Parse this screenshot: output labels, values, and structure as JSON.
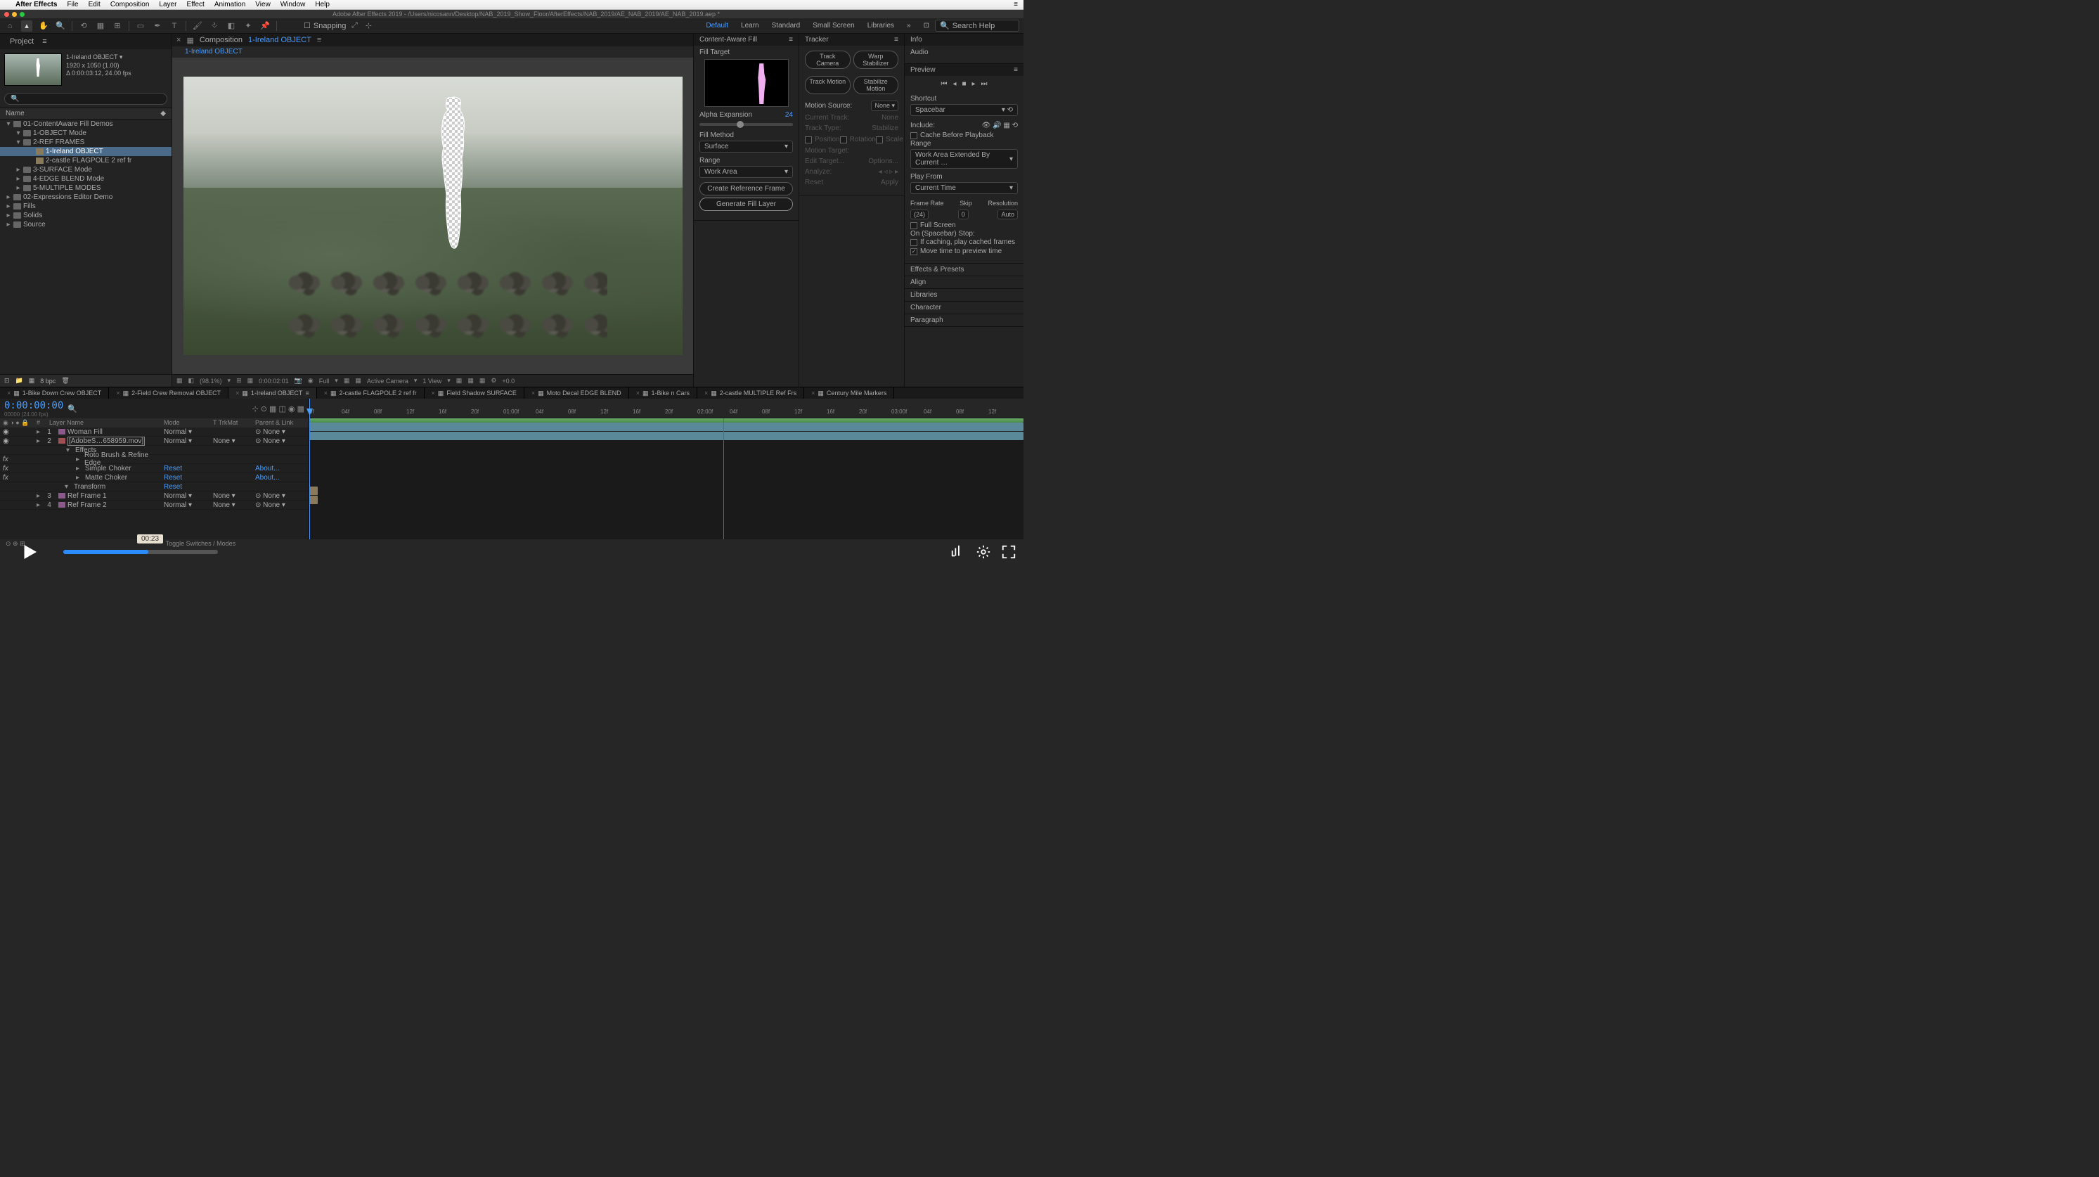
{
  "menubar": {
    "app": "After Effects",
    "items": [
      "File",
      "Edit",
      "Composition",
      "Layer",
      "Effect",
      "Animation",
      "View",
      "Window",
      "Help"
    ]
  },
  "window_title": "Adobe After Effects 2019 - /Users/nicosann/Desktop/NAB_2019_Show_Floor/AfterEffects/NAB_2019/AE_NAB_2019/AE_NAB_2019.aep *",
  "toolbar": {
    "snapping": "Snapping",
    "workspaces": [
      "Default",
      "Learn",
      "Standard",
      "Small Screen",
      "Libraries"
    ],
    "search_placeholder": "Search Help"
  },
  "project": {
    "panel_title": "Project",
    "comp_name": "1-Ireland OBJECT ▾",
    "comp_res": "1920 x 1050 (1.00)",
    "comp_dur": "Δ 0:00:03:12, 24.00 fps",
    "name_header": "Name",
    "tree": [
      {
        "l": 1,
        "t": "folder",
        "open": true,
        "label": "01-ContentAware Fill Demos"
      },
      {
        "l": 2,
        "t": "folder",
        "open": true,
        "label": "1-OBJECT Mode"
      },
      {
        "l": 2,
        "t": "folder",
        "open": true,
        "label": "2-REF FRAMES"
      },
      {
        "l": 3,
        "t": "comp",
        "sel": true,
        "label": "1-Ireland OBJECT"
      },
      {
        "l": 3,
        "t": "comp",
        "label": "2-castle FLAGPOLE 2 ref fr"
      },
      {
        "l": 2,
        "t": "folder",
        "label": "3-SURFACE Mode"
      },
      {
        "l": 2,
        "t": "folder",
        "label": "4-EDGE BLEND Mode"
      },
      {
        "l": 2,
        "t": "folder",
        "label": "5-MULTIPLE MODES"
      },
      {
        "l": 1,
        "t": "folder",
        "label": "02-Expressions Editor Demo"
      },
      {
        "l": 1,
        "t": "folder",
        "label": "Fills"
      },
      {
        "l": 1,
        "t": "folder",
        "label": "Solids"
      },
      {
        "l": 1,
        "t": "folder",
        "label": "Source"
      }
    ],
    "bpc": "8 bpc"
  },
  "composition": {
    "tab_prefix": "Composition",
    "tab_name": "1-Ireland OBJECT",
    "breadcrumb": "1-Ireland OBJECT",
    "footer": {
      "zoom": "(98.1%)",
      "time": "0:00:02:01",
      "res": "Full",
      "camera": "Active Camera",
      "view": "1 View",
      "exposure": "+0.0"
    }
  },
  "caf": {
    "title": "Content-Aware Fill",
    "fill_target": "Fill Target",
    "alpha_exp": "Alpha Expansion",
    "alpha_val": "24",
    "fill_method": "Fill Method",
    "fill_method_val": "Surface",
    "range": "Range",
    "range_val": "Work Area",
    "btn_ref": "Create Reference Frame",
    "btn_gen": "Generate Fill Layer"
  },
  "tracker": {
    "title": "Tracker",
    "btns": [
      "Track Camera",
      "Warp Stabilizer",
      "Track Motion",
      "Stabilize Motion"
    ],
    "motion_source": "Motion Source:",
    "motion_source_val": "None",
    "current_track": "Current Track:",
    "current_track_val": "None",
    "track_type": "Track Type:",
    "track_type_val": "Stabilize",
    "opts": [
      "Position",
      "Rotation",
      "Scale"
    ],
    "motion_target": "Motion Target:",
    "edit_target": "Edit Target...",
    "options": "Options...",
    "analyze": "Analyze:",
    "reset": "Reset",
    "apply": "Apply"
  },
  "info": {
    "title": "Info",
    "audio": "Audio"
  },
  "preview": {
    "title": "Preview",
    "shortcut": "Shortcut",
    "shortcut_val": "Spacebar",
    "include": "Include:",
    "cache": "Cache Before Playback",
    "range": "Range",
    "range_val": "Work Area Extended By Current …",
    "play_from": "Play From",
    "play_from_val": "Current Time",
    "frame_rate": "Frame Rate",
    "skip": "Skip",
    "resolution": "Resolution",
    "fr_val": "(24)",
    "skip_val": "0",
    "res_val": "Auto",
    "fullscreen": "Full Screen",
    "on_stop": "On (Spacebar) Stop:",
    "cached": "If caching, play cached frames",
    "move_time": "Move time to preview time"
  },
  "panels_collapsed": [
    "Effects & Presets",
    "Align",
    "Libraries",
    "Character",
    "Paragraph"
  ],
  "timeline": {
    "tabs": [
      "1-Bike Down Crew OBJECT",
      "2-Field Crew Removal OBJECT",
      "1-Ireland OBJECT",
      "2-castle FLAGPOLE 2 ref fr",
      "Field Shadow SURFACE",
      "Moto Decal EDGE BLEND",
      "1-Bike n Cars",
      "2-castle MULTIPLE Ref Frs",
      "Century Mile Markers"
    ],
    "active_tab": 2,
    "timecode": "0:00:00:00",
    "subtime": "00000 (24.00 fps)",
    "cols": {
      "num": "#",
      "name": "Layer Name",
      "mode": "Mode",
      "trk": "T  TrkMat",
      "parent": "Parent & Link"
    },
    "layers": [
      {
        "num": "1",
        "name": "Woman Fill",
        "mode": "Normal",
        "trk": "",
        "parent": "None",
        "icon": "purple",
        "eye": true
      },
      {
        "num": "2",
        "name": "[AdobeS…658959.mov]",
        "mode": "Normal",
        "trk": "None",
        "parent": "None",
        "icon": "red",
        "eye": true,
        "box": true
      },
      {
        "effects_hdr": true,
        "name": "Effects"
      },
      {
        "effect": true,
        "name": "Roto Brush & Refine Edge"
      },
      {
        "effect": true,
        "name": "Simple Choker",
        "reset": "Reset",
        "about": "About..."
      },
      {
        "effect": true,
        "name": "Matte Choker",
        "reset": "Reset",
        "about": "About..."
      },
      {
        "sub": true,
        "name": "Transform",
        "reset": "Reset"
      },
      {
        "num": "3",
        "name": "Ref Frame 1",
        "mode": "Normal",
        "trk": "None",
        "parent": "None",
        "icon": "tan"
      },
      {
        "num": "4",
        "name": "Ref Frame 2",
        "mode": "Normal",
        "trk": "None",
        "parent": "None",
        "icon": "tan"
      }
    ],
    "ruler": [
      "0f",
      "04f",
      "08f",
      "12f",
      "16f",
      "20f",
      "01:00f",
      "04f",
      "08f",
      "12f",
      "16f",
      "20f",
      "02:00f",
      "04f",
      "08f",
      "12f",
      "16f",
      "20f",
      "03:00f",
      "04f",
      "08f",
      "12f"
    ],
    "toggle": "Toggle Switches / Modes"
  },
  "player": {
    "time": "00:23"
  }
}
